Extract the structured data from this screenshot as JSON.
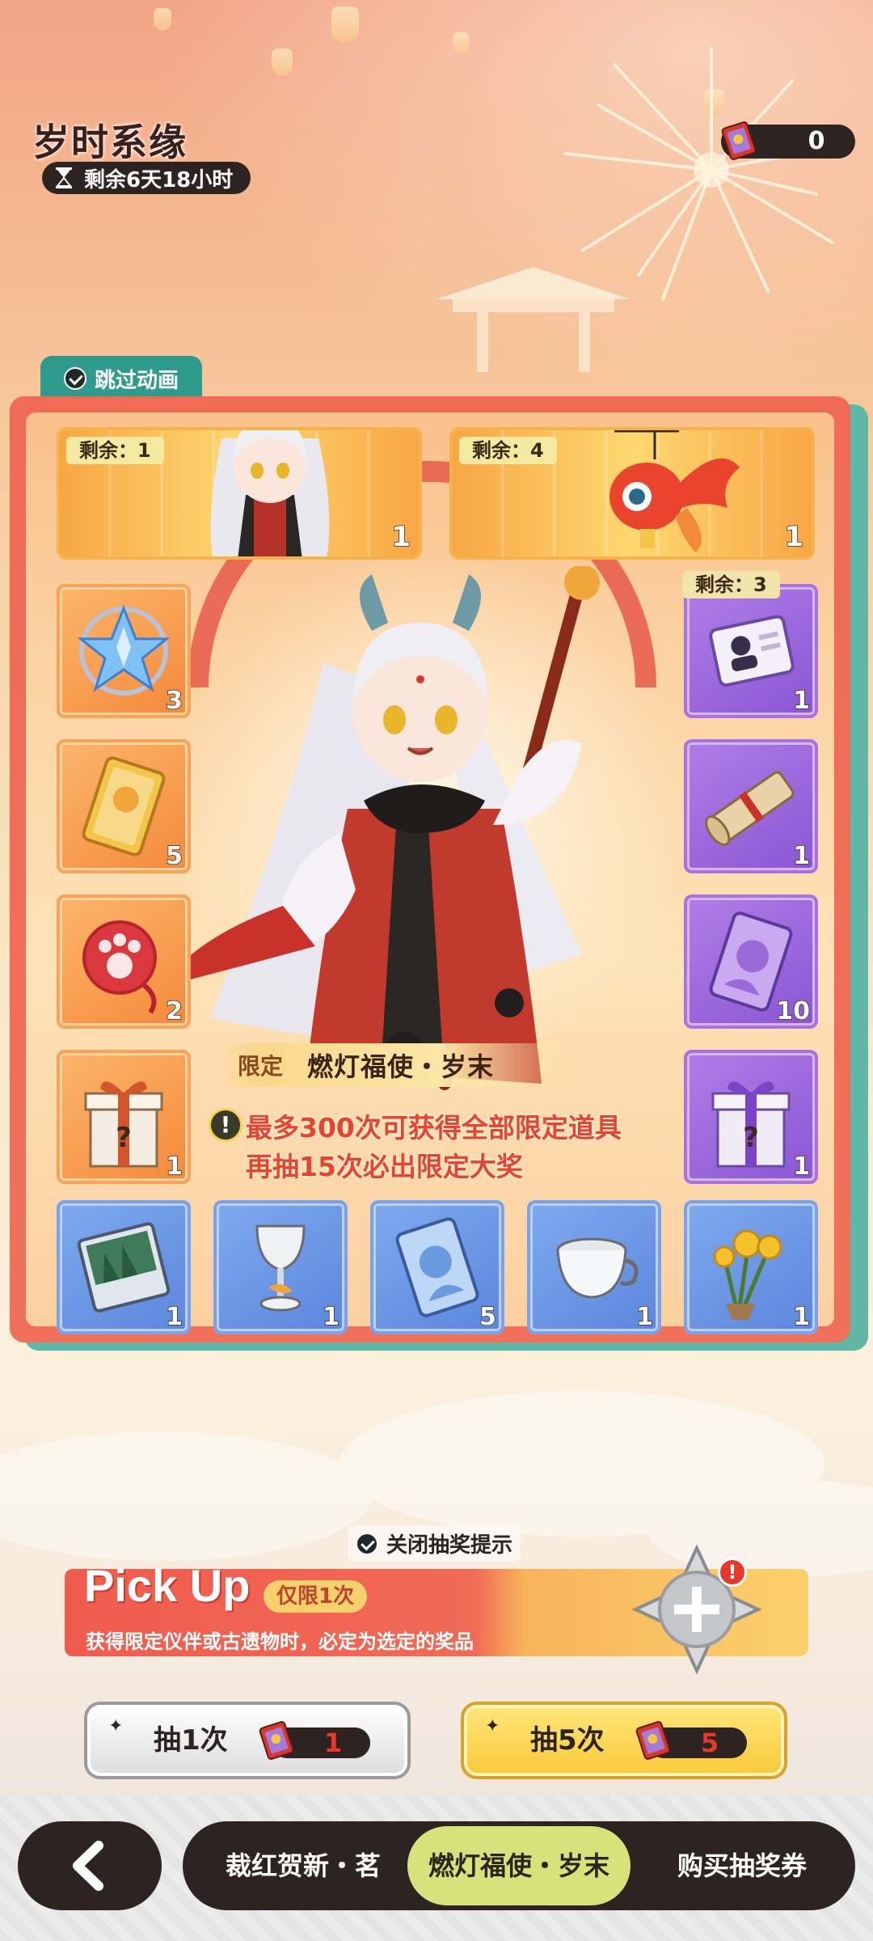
{
  "header": {
    "title": "岁时系缘",
    "timer": "剩余6天18小时",
    "ticket_count": "0"
  },
  "board": {
    "skip_animation": "跳过动画",
    "grand_prizes": [
      {
        "remaining": "剩余：1",
        "count": "1",
        "icon": "character-portrait"
      },
      {
        "remaining": "剩余：4",
        "count": "1",
        "icon": "goldfish-lantern"
      }
    ],
    "purple_remaining": "剩余：3",
    "left_column": [
      {
        "count": "3",
        "icon": "crystal-star"
      },
      {
        "count": "5",
        "icon": "gold-card"
      },
      {
        "count": "2",
        "icon": "paw-mirror"
      },
      {
        "count": "1",
        "icon": "mystery-gift-orange"
      }
    ],
    "right_column": [
      {
        "count": "1",
        "icon": "mystery-card"
      },
      {
        "count": "1",
        "icon": "scroll"
      },
      {
        "count": "10",
        "icon": "character-card-purple"
      },
      {
        "count": "1",
        "icon": "mystery-gift-purple"
      }
    ],
    "bottom_row": [
      {
        "count": "1",
        "icon": "forest-book"
      },
      {
        "count": "1",
        "icon": "goblet"
      },
      {
        "count": "5",
        "icon": "character-card-blue"
      },
      {
        "count": "1",
        "icon": "teacup"
      },
      {
        "count": "1",
        "icon": "flower-bouquet"
      }
    ],
    "limited_label": "限定",
    "limited_name": "燃灯福使・岁末",
    "notice_line1": "最多300次可获得全部限定道具",
    "notice_line2": "再抽15次必出限定大奖"
  },
  "pickup": {
    "close_tip": "关闭抽奖提示",
    "title": "Pick Up",
    "once_badge": "仅限1次",
    "description": "获得限定仪伴或古遗物时，必定为选定的奖品",
    "alert": "!"
  },
  "draw": {
    "one_label": "抽1次",
    "one_cost": "1",
    "five_label": "抽5次",
    "five_cost": "5"
  },
  "nav": {
    "back": "back",
    "tabs": [
      "裁红贺新・茗",
      "燃灯福使・岁末",
      "购买抽奖券"
    ],
    "active_index": 1
  },
  "colors": {
    "board_red": "#ef6b55",
    "teal": "#2f9b8c",
    "orange_tile": "#f4893b",
    "purple_tile": "#8a55d4",
    "blue_tile": "#5b86dc",
    "active_tab": "#d5e37a",
    "notice_red": "#e8432f"
  }
}
